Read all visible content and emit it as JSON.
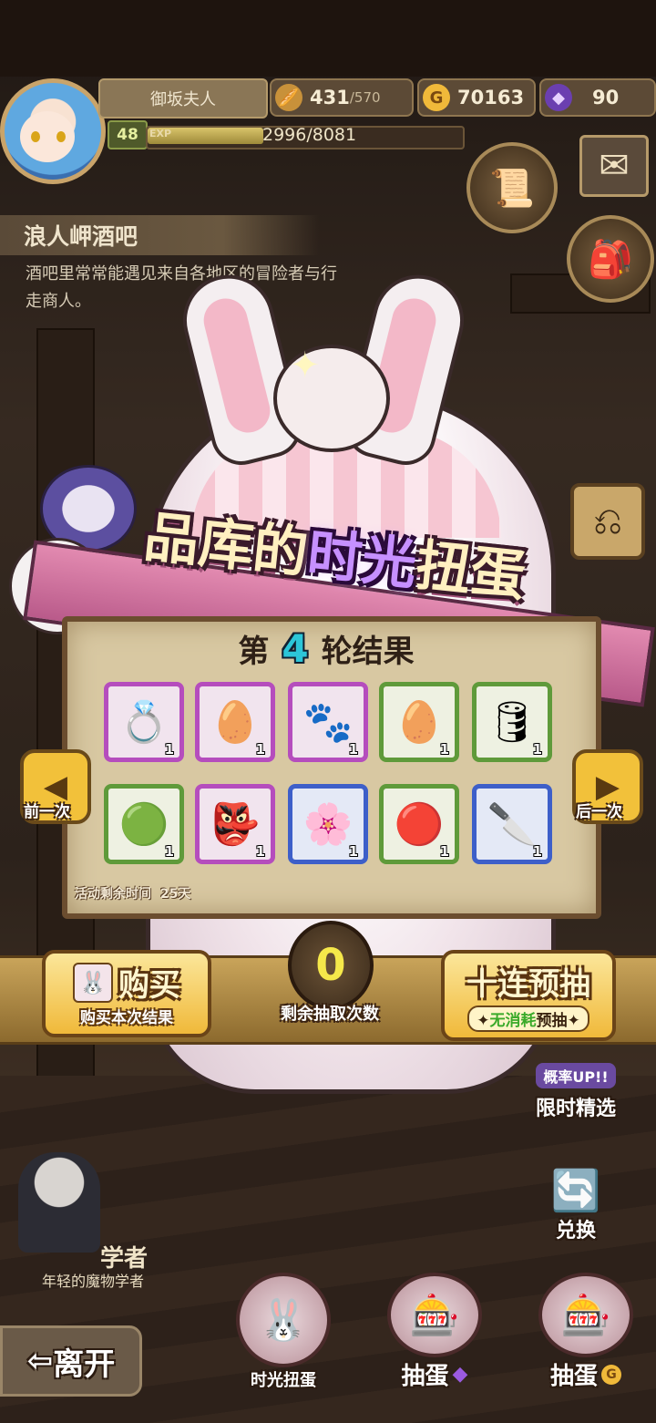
{
  "player": {
    "name": "御坂夫人",
    "level": "48",
    "exp_label": "EXP",
    "exp_text": "2996/8081",
    "exp_fraction": 0.371
  },
  "resources": {
    "stamina_value": "431",
    "stamina_max": "/570",
    "gold_value": "70163",
    "gem_value": "90"
  },
  "location": {
    "title": "浪人岬酒吧",
    "description": "酒吧里常常能遇见来自各地区的冒险者与行走商人。"
  },
  "event": {
    "title_part1": "品库的",
    "title_highlight": "时光",
    "title_part2": "扭蛋",
    "round_prefix": "第",
    "round_number": "4",
    "round_suffix": "轮结果",
    "remaining_time_label": "活动剩余时间",
    "remaining_time_value": "25天"
  },
  "results": [
    {
      "icon": "crystal-ring-icon",
      "rarity": "purple",
      "qty": "1",
      "glyph": "💍"
    },
    {
      "icon": "bound-tiger-egg-icon",
      "rarity": "purple",
      "qty": "1",
      "glyph": "🥚"
    },
    {
      "icon": "fluffy-creature-icon",
      "rarity": "purple",
      "qty": "1",
      "glyph": "🐾"
    },
    {
      "icon": "green-spotted-egg-icon",
      "rarity": "green",
      "qty": "1",
      "glyph": "🥚"
    },
    {
      "icon": "wooden-barrel-egg-icon",
      "rarity": "green",
      "qty": "1",
      "glyph": "🛢"
    },
    {
      "icon": "green-slime-egg-icon",
      "rarity": "green",
      "qty": "1",
      "glyph": "🟢"
    },
    {
      "icon": "demon-mask-icon",
      "rarity": "purple",
      "qty": "1",
      "glyph": "👺"
    },
    {
      "icon": "sakura-egg-icon",
      "rarity": "blue",
      "qty": "1",
      "glyph": "🌸"
    },
    {
      "icon": "red-swirl-egg-icon",
      "rarity": "green",
      "qty": "1",
      "glyph": "🔴"
    },
    {
      "icon": "cleaver-knife-icon",
      "rarity": "blue",
      "qty": "1",
      "glyph": "🔪"
    }
  ],
  "nav": {
    "prev_label": "前一次",
    "next_label": "后一次"
  },
  "actions": {
    "buy_label": "购买",
    "buy_sub": "购买本次结果",
    "counter_value": "0",
    "counter_label": "剩余抽取次数",
    "preview_label": "十连预抽",
    "preview_sub_highlight": "无消耗",
    "preview_sub": "预抽"
  },
  "side_features": {
    "limited_badge": "概率UP!!",
    "limited_label": "限时精选",
    "exchange_label": "兑换"
  },
  "npc": {
    "name": "学者",
    "description": "年轻的魔物学者"
  },
  "bottom": {
    "leave_label": "离开",
    "time_gacha_label": "时光扭蛋",
    "gacha_gem_label": "抽蛋",
    "gacha_gold_label": "抽蛋"
  },
  "colors": {
    "accent_gold": "#f0b93a",
    "rarity_purple": "#b54dbd",
    "rarity_green": "#5f9a3a",
    "rarity_blue": "#3d5fc9",
    "round_number": "#2cc6d8",
    "counter": "#f5e84a"
  }
}
